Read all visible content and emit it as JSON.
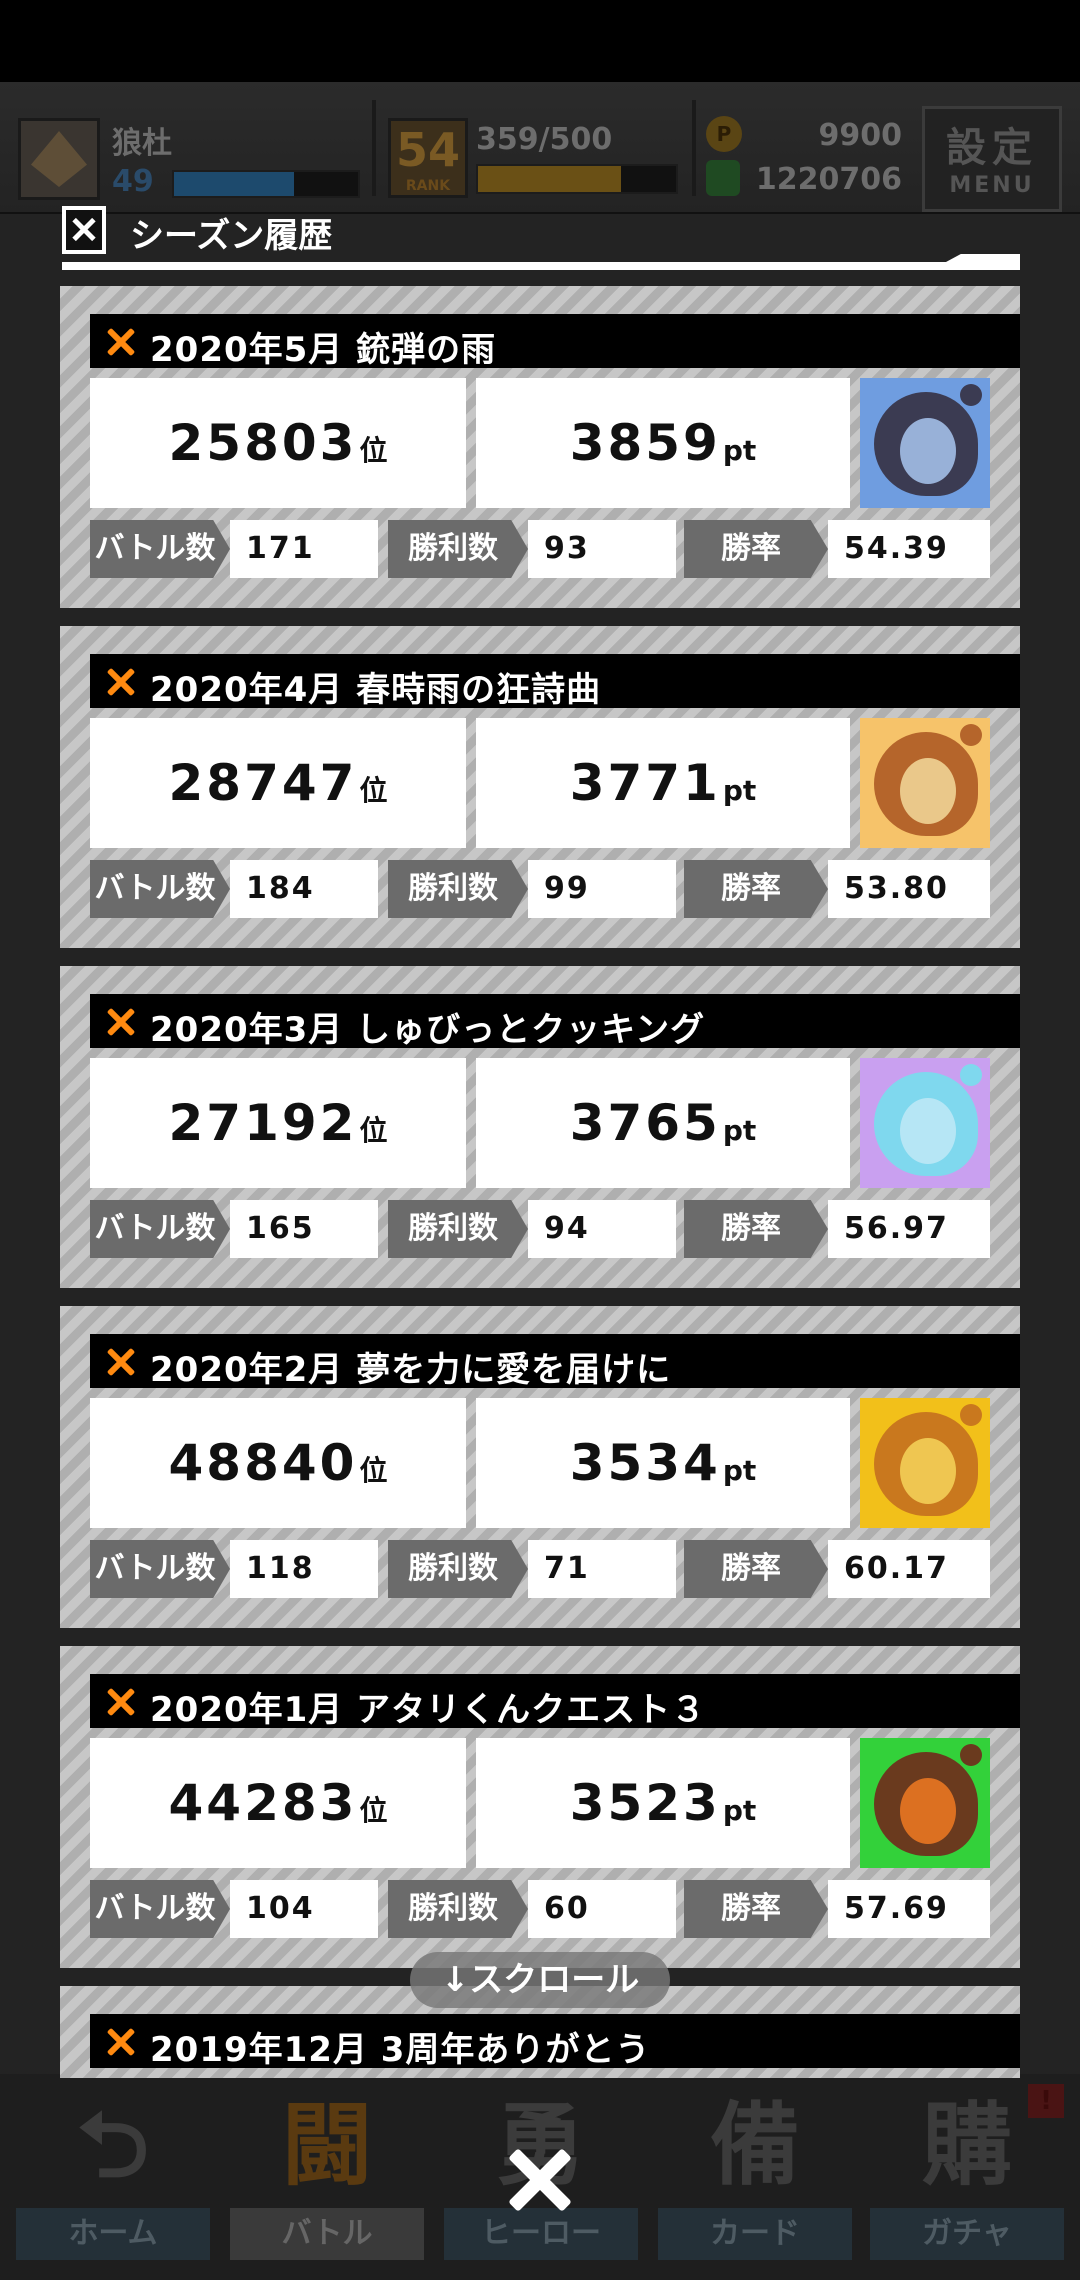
{
  "header": {
    "player_name": "狼杜",
    "level": "49",
    "rank_label": "RANK",
    "rank_number": "54",
    "rank_progress": "359/500",
    "rank_fill_fraction": 0.72,
    "level_fill_fraction": 0.65,
    "coin_symbol": "P",
    "coins": "9900",
    "gems": "1220706",
    "menu_kanji": "設定",
    "menu_label": "MENU"
  },
  "modal": {
    "title": "シーズン履歴",
    "scroll_hint": "↓スクロール",
    "close_icon": "close-x"
  },
  "labels": {
    "battles": "バトル数",
    "wins": "勝利数",
    "win_rate": "勝率",
    "rank_unit": "位",
    "pt_unit": "pt"
  },
  "seasons": [
    {
      "title": "2020年5月 銃弾の雨",
      "rank": "25803",
      "points": "3859",
      "battles": "171",
      "wins": "93",
      "win_rate": "54.39",
      "avatar_bg": "#6f9de0",
      "avatar_hair": "#3b3b52",
      "avatar_face": "#a9c7f0"
    },
    {
      "title": "2020年4月 春時雨の狂詩曲",
      "rank": "28747",
      "points": "3771",
      "battles": "184",
      "wins": "99",
      "win_rate": "53.80",
      "avatar_bg": "#f6c36a",
      "avatar_hair": "#b5652b",
      "avatar_face": "#f3d99b"
    },
    {
      "title": "2020年3月 しゅびっとクッキング",
      "rank": "27192",
      "points": "3765",
      "battles": "165",
      "wins": "94",
      "win_rate": "56.97",
      "avatar_bg": "#c9a0f0",
      "avatar_hair": "#7fd8ee",
      "avatar_face": "#bfe9f6"
    },
    {
      "title": "2020年2月 夢を力に愛を届けに",
      "rank": "48840",
      "points": "3534",
      "battles": "118",
      "wins": "71",
      "win_rate": "60.17",
      "avatar_bg": "#f2c01a",
      "avatar_hair": "#c9781e",
      "avatar_face": "#f6d45a"
    },
    {
      "title": "2020年1月 アタリくんクエスト３",
      "rank": "44283",
      "points": "3523",
      "battles": "104",
      "wins": "60",
      "win_rate": "57.69",
      "avatar_bg": "#33d13a",
      "avatar_hair": "#6a3a1e",
      "avatar_face": "#f07a22"
    },
    {
      "title": "2019年12月 3周年ありがとう"
    }
  ],
  "bottom_nav": [
    {
      "label": "ホーム",
      "glyph": "⮌"
    },
    {
      "label": "バトル",
      "glyph": "闘"
    },
    {
      "label": "ヒーロー",
      "glyph": "勇"
    },
    {
      "label": "カード",
      "glyph": "備"
    },
    {
      "label": "ガチャ",
      "glyph": "購"
    }
  ],
  "nav_alert": "!"
}
